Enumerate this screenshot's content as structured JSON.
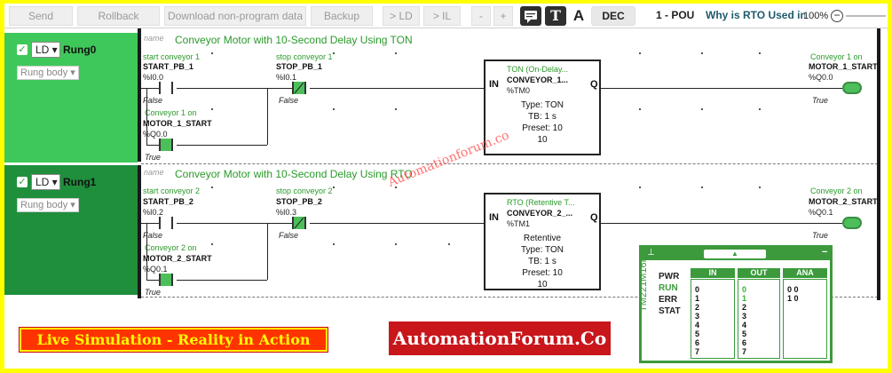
{
  "toolbar": {
    "send": "Send",
    "rollback": "Rollback",
    "download": "Download non-program data",
    "backup": "Backup",
    "to_ld": "> LD",
    "to_il": "> IL",
    "minus": "-",
    "plus": "+",
    "text_icon": "T",
    "font_icon": "A",
    "dec": "DEC",
    "pou_label": "1 - POU",
    "pou_name": "Why is RTO Used in Place of TON",
    "zoom": "100%"
  },
  "rungs": [
    {
      "lang": "LD",
      "name": "Rung0",
      "body": "Rung body",
      "name_placeholder": "name",
      "title": "Conveyor Motor with 10-Second Delay Using TON",
      "contact1": {
        "comment": "start conveyor 1",
        "name": "START_PB_1",
        "address": "%I0.0",
        "state": "False"
      },
      "contact2": {
        "comment": "stop conveyor 1",
        "name": "STOP_PB_1",
        "address": "%I0.1",
        "state": "False"
      },
      "latch": {
        "comment": "Conveyor 1 on",
        "name": "MOTOR_1_START",
        "address": "%Q0.0",
        "state": "True"
      },
      "block": {
        "title": "TON (On-Delay...",
        "name": "CONVEYOR_1...",
        "address": "%TM0",
        "in": "IN",
        "q": "Q",
        "mode": "",
        "type": "Type: TON",
        "tb": "TB: 1 s",
        "preset": "Preset: 10",
        "value": "10"
      },
      "coil": {
        "comment": "Conveyor 1 on",
        "name": "MOTOR_1_START",
        "address": "%Q0.0",
        "state": "True"
      }
    },
    {
      "lang": "LD",
      "name": "Rung1",
      "body": "Rung body",
      "name_placeholder": "name",
      "title": "Conveyor Motor with 10-Second Delay Using RTO",
      "contact1": {
        "comment": "start conveyor 2",
        "name": "START_PB_2",
        "address": "%I0.2",
        "state": "False"
      },
      "contact2": {
        "comment": "stop conveyor 2",
        "name": "STOP_PB_2",
        "address": "%I0.3",
        "state": "False"
      },
      "latch": {
        "comment": "Conveyor 2 on",
        "name": "MOTOR_2_START",
        "address": "%Q0.1",
        "state": "True"
      },
      "block": {
        "title": "RTO (Retentive T...",
        "name": "CONVEYOR_2_...",
        "address": "%TM1",
        "in": "IN",
        "q": "Q",
        "mode": "Retentive",
        "type": "Type: TON",
        "tb": "TB: 1 s",
        "preset": "Preset: 10",
        "value": "10"
      },
      "coil": {
        "comment": "Conveyor 2 on",
        "name": "MOTOR_2_START",
        "address": "%Q0.1",
        "state": "True"
      }
    }
  ],
  "watermark": "Automationforum.co",
  "banner_left": "Live Simulation - Reality in Action",
  "banner_right": "AutomationForum.Co",
  "panel": {
    "model": "TM221M16R/G",
    "labels": {
      "pwr": "PWR",
      "run": "RUN",
      "err": "ERR",
      "stat": "STAT"
    },
    "headers": {
      "in": "IN",
      "out": "OUT",
      "ana": "ANA"
    },
    "in": [
      "0",
      "1",
      "2",
      "3",
      "4",
      "5",
      "6",
      "7"
    ],
    "out": [
      "0",
      "1",
      "2",
      "3",
      "4",
      "5",
      "6",
      "7"
    ],
    "ana": [
      "0 0",
      "1 0"
    ]
  },
  "colors": {
    "rung0_bg": "#3fc85a",
    "rung1_bg": "#1f8f3c",
    "accent_green": "#3c9a3c",
    "banner_red": "#c8161b",
    "frame_yellow": "#ffff00"
  }
}
